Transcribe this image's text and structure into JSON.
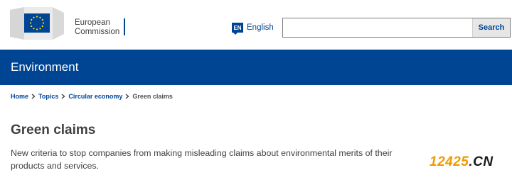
{
  "header": {
    "logo": {
      "line1": "European",
      "line2": "Commission"
    },
    "language": {
      "code": "EN",
      "label": "English"
    },
    "search": {
      "value": "",
      "placeholder": "",
      "button_label": "Search"
    }
  },
  "banner": {
    "title": "Environment"
  },
  "breadcrumb": {
    "items": [
      "Home",
      "Topics",
      "Circular economy"
    ],
    "current": "Green claims"
  },
  "main": {
    "title": "Green claims",
    "intro": "New criteria to stop companies from making misleading claims about environmental merits of their products and services."
  },
  "watermark": {
    "number": "12425",
    "dot": ".",
    "suffix": "CN"
  },
  "colors": {
    "brand": "#004494",
    "text": "#404040",
    "watermark": "#f29a00"
  },
  "icons": [
    "eu-flag-icon",
    "language-icon",
    "chevron-right-icon"
  ]
}
